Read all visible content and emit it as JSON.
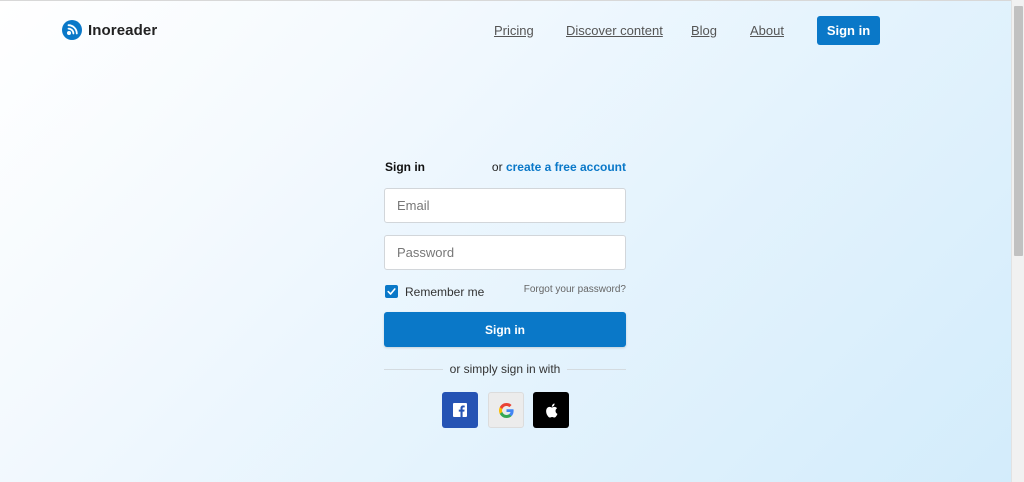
{
  "header": {
    "brand": "Inoreader",
    "nav": [
      "Pricing",
      "Discover content",
      "Blog",
      "About"
    ],
    "signin_button": "Sign in"
  },
  "form": {
    "title": "Sign in",
    "or_text": "or",
    "create_account_link": "create a free account",
    "email_placeholder": "Email",
    "password_placeholder": "Password",
    "remember_me_label": "Remember me",
    "remember_me_checked": true,
    "forgot_password_link": "Forgot your password?",
    "submit_button": "Sign in",
    "social_divider_text": "or simply sign in with"
  },
  "social": {
    "facebook": "facebook-icon",
    "google": "google-icon",
    "apple": "apple-icon"
  },
  "colors": {
    "accent": "#0a78c8",
    "facebook": "#2553b4"
  }
}
